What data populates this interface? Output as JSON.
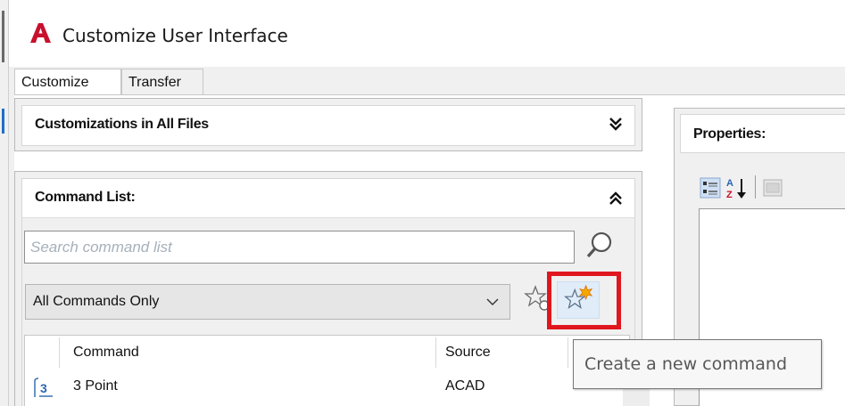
{
  "window": {
    "title": "Customize User Interface"
  },
  "tabs": [
    {
      "label": "Customize",
      "active": true
    },
    {
      "label": "Transfer",
      "active": false
    }
  ],
  "customizations_panel": {
    "title": "Customizations in All Files",
    "state": "collapsed"
  },
  "command_list_panel": {
    "title": "Command List:",
    "state": "expanded",
    "search": {
      "placeholder": "Search command list",
      "value": ""
    },
    "filter": {
      "selected": "All Commands Only"
    },
    "columns": [
      {
        "label": "Command"
      },
      {
        "label": "Source"
      }
    ],
    "rows": [
      {
        "icon": "three-point-arc-icon",
        "command": "3 Point",
        "source": "ACAD"
      }
    ]
  },
  "properties_panel": {
    "title": "Properties:"
  },
  "tooltip": {
    "text": "Create a new command"
  },
  "colors": {
    "brand_red": "#c8102e",
    "highlight_red": "#e0161f",
    "tooltip_text": "#575757",
    "placeholder": "#a6b0bb"
  },
  "icons": {
    "app": "autocad-logo-icon",
    "collapse": "double-chevron-down-icon",
    "expand": "double-chevron-up-icon",
    "search": "magnifier-icon",
    "favorites": "star-search-icon",
    "new_command": "new-star-icon",
    "categorized": "categorized-view-icon",
    "alphabetical": "sort-az-icon",
    "property_pages": "property-pages-icon"
  }
}
